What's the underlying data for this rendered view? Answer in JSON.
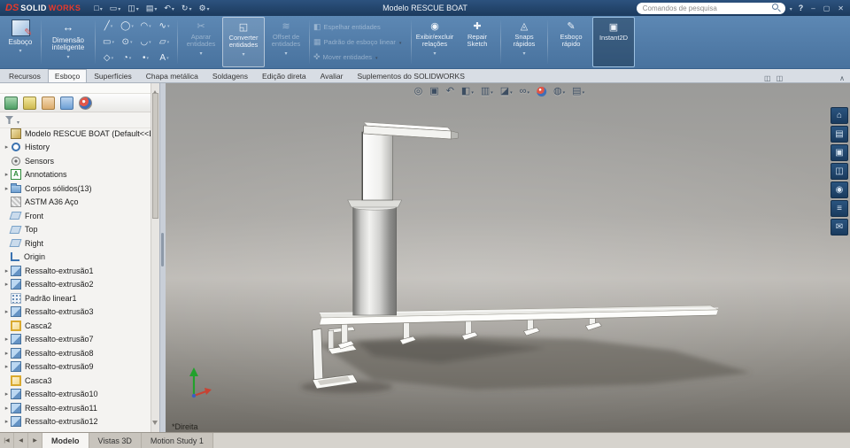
{
  "titlebar": {
    "logo_ds": "DS",
    "logo_solid": "SOLID",
    "logo_works": "WORKS",
    "title": "Modelo RESCUE BOAT",
    "search_placeholder": "Comandos de pesquisa",
    "help": "?",
    "minimize": "–",
    "maximize": "▢",
    "close": "✕",
    "quick_tools": [
      {
        "name": "new-document-icon",
        "glyph": "□"
      },
      {
        "name": "open-document-icon",
        "glyph": "▭"
      },
      {
        "name": "save-icon",
        "glyph": "◫"
      },
      {
        "name": "print-icon",
        "glyph": "▤"
      },
      {
        "name": "undo-icon",
        "glyph": "↶"
      },
      {
        "name": "rebuild-icon",
        "glyph": "↻"
      },
      {
        "name": "options-icon",
        "glyph": "⚙"
      }
    ]
  },
  "ribbon": {
    "sketch": {
      "label": "Esboço"
    },
    "smart_dimension": {
      "label": "Dimensão inteligente",
      "icon": "↔"
    },
    "sketch_tools": [
      {
        "name": "line-icon",
        "glyph": "╱"
      },
      {
        "name": "circle-icon",
        "glyph": "◯"
      },
      {
        "name": "arc-icon",
        "glyph": "◠"
      },
      {
        "name": "spline-icon",
        "glyph": "∿"
      },
      {
        "name": "rectangle-icon",
        "glyph": "▭"
      },
      {
        "name": "perimeter-circle-icon",
        "glyph": "⊙"
      },
      {
        "name": "tangent-arc-icon",
        "glyph": "◡"
      },
      {
        "name": "parallelogram-icon",
        "glyph": "▱"
      },
      {
        "name": "polygon-icon",
        "glyph": "◇"
      },
      {
        "name": "ellipse-icon",
        "glyph": "◔"
      },
      {
        "name": "point-icon",
        "glyph": "•"
      },
      {
        "name": "text-icon",
        "glyph": "A"
      }
    ],
    "trim": {
      "label": "Aparar entidades",
      "icon": "✂"
    },
    "convert": {
      "label": "Converter entidades",
      "icon": "◱"
    },
    "offset": {
      "label": "Offset de entidades",
      "icon": "≋"
    },
    "row_buttons": [
      {
        "name": "mirror-entities-button",
        "label": "Espelhar entidades",
        "icon": "◧",
        "caret": ""
      },
      {
        "name": "linear-sketch-pattern-button",
        "label": "Padrão de esboço linear",
        "icon": "▦",
        "caret": "c"
      },
      {
        "name": "move-entities-button",
        "label": "Mover entidades",
        "icon": "✜",
        "caret": "c"
      }
    ],
    "relations": {
      "label": "Exibir/excluir relações",
      "icon": "◉"
    },
    "repair": {
      "label": "Repair Sketch",
      "icon": "✚"
    },
    "snaps": {
      "label": "Snaps rápidos",
      "icon": "◬"
    },
    "rapid_sketch": {
      "label": "Esboço rápido",
      "icon": "✎"
    },
    "instant2d": {
      "label": "Instant2D",
      "icon": "▣"
    }
  },
  "command_tabs": [
    {
      "label": "Recursos",
      "state": ""
    },
    {
      "label": "Esboço",
      "state": "active"
    },
    {
      "label": "Superfícies",
      "state": ""
    },
    {
      "label": "Chapa metálica",
      "state": ""
    },
    {
      "label": "Soldagens",
      "state": ""
    },
    {
      "label": "Edição direta",
      "state": ""
    },
    {
      "label": "Avaliar",
      "state": ""
    },
    {
      "label": "Suplementos do SOLIDWORKS",
      "state": ""
    }
  ],
  "tab_icons": [
    {
      "name": "undock-commandmanager-icon",
      "glyph": "◫"
    },
    {
      "name": "split-view-icon",
      "glyph": "◫"
    }
  ],
  "tab_icons_right": [
    {
      "name": "collapse-ribbon-icon",
      "glyph": "∧"
    }
  ],
  "panel": {
    "more": "»",
    "tabs": [
      {
        "name": "featuremanager-tree-icon",
        "cls": "pt-tree"
      },
      {
        "name": "propertymanager-icon",
        "cls": "pt-prop"
      },
      {
        "name": "configurationmanager-icon",
        "cls": "pt-config"
      },
      {
        "name": "dimxpertmanager-icon",
        "cls": "pt-dim"
      },
      {
        "name": "displaymanager-icon",
        "cls": "pt-display"
      }
    ]
  },
  "tree": {
    "root": "Modelo RESCUE BOAT  (Default<<Default",
    "items": [
      {
        "label": "History",
        "icon": "history",
        "icon_name": "history-icon",
        "arrow": "▸"
      },
      {
        "label": "Sensors",
        "icon": "sensors",
        "icon_name": "sensors-icon",
        "arrow": ""
      },
      {
        "label": "Annotations",
        "icon": "annotations",
        "icon_name": "annotations-icon",
        "arrow": "▸"
      },
      {
        "label": "Corpos sólidos(13)",
        "icon": "folder",
        "icon_name": "solid-bodies-folder-icon",
        "arrow": "▸"
      },
      {
        "label": "ASTM A36 Aço",
        "icon": "material",
        "icon_name": "material-icon",
        "arrow": ""
      },
      {
        "label": "Front",
        "icon": "plane",
        "icon_name": "front-plane-icon",
        "arrow": ""
      },
      {
        "label": "Top",
        "icon": "plane",
        "icon_name": "top-plane-icon",
        "arrow": ""
      },
      {
        "label": "Right",
        "icon": "plane",
        "icon_name": "right-plane-icon",
        "arrow": ""
      },
      {
        "label": "Origin",
        "icon": "origin",
        "icon_name": "origin-icon",
        "arrow": ""
      },
      {
        "label": "Ressalto-extrusão1",
        "icon": "extrude",
        "icon_name": "boss-extrude-icon",
        "arrow": "▸"
      },
      {
        "label": "Ressalto-extrusão2",
        "icon": "extrude",
        "icon_name": "boss-extrude-icon",
        "arrow": "▸"
      },
      {
        "label": "Padrão linear1",
        "icon": "pattern",
        "icon_name": "linear-pattern-icon",
        "arrow": ""
      },
      {
        "label": "Ressalto-extrusão3",
        "icon": "extrude",
        "icon_name": "boss-extrude-icon",
        "arrow": "▸"
      },
      {
        "label": "Casca2",
        "icon": "shell",
        "icon_name": "shell-icon",
        "arrow": ""
      },
      {
        "label": "Ressalto-extrusão7",
        "icon": "extrude",
        "icon_name": "boss-extrude-icon",
        "arrow": "▸"
      },
      {
        "label": "Ressalto-extrusão8",
        "icon": "extrude",
        "icon_name": "boss-extrude-icon",
        "arrow": "▸"
      },
      {
        "label": "Ressalto-extrusão9",
        "icon": "extrude",
        "icon_name": "boss-extrude-icon",
        "arrow": "▸"
      },
      {
        "label": "Casca3",
        "icon": "shell",
        "icon_name": "shell-icon",
        "arrow": ""
      },
      {
        "label": "Ressalto-extrusão10",
        "icon": "extrude",
        "icon_name": "boss-extrude-icon",
        "arrow": "▸"
      },
      {
        "label": "Ressalto-extrusão11",
        "icon": "extrude",
        "icon_name": "boss-extrude-icon",
        "arrow": "▸"
      },
      {
        "label": "Ressalto-extrusão12",
        "icon": "extrude",
        "icon_name": "boss-extrude-icon",
        "arrow": "▸"
      }
    ]
  },
  "viewport": {
    "view_label": "*Direita",
    "hud": [
      {
        "name": "zoom-to-fit-icon",
        "glyph": "◎",
        "caret": "",
        "cls": ""
      },
      {
        "name": "zoom-to-area-icon",
        "glyph": "▣",
        "caret": "",
        "cls": ""
      },
      {
        "name": "previous-view-icon",
        "glyph": "↶",
        "caret": "",
        "cls": ""
      },
      {
        "name": "section-view-icon",
        "glyph": "◧",
        "caret": "c",
        "cls": ""
      },
      {
        "name": "view-orientation-icon",
        "glyph": "▥",
        "caret": "c",
        "cls": ""
      },
      {
        "name": "display-style-icon",
        "glyph": "◪",
        "caret": "c",
        "cls": ""
      },
      {
        "name": "hide-show-items-icon",
        "glyph": "∞",
        "caret": "c",
        "cls": ""
      },
      {
        "name": "edit-appearance-icon",
        "glyph": "",
        "caret": "",
        "cls": "ball"
      },
      {
        "name": "apply-scene-icon",
        "glyph": "◍",
        "caret": "c",
        "cls": ""
      },
      {
        "name": "view-settings-icon",
        "glyph": "▤",
        "caret": "c",
        "cls": ""
      }
    ],
    "task_pane": [
      {
        "name": "home-icon",
        "glyph": "⌂"
      },
      {
        "name": "design-library-icon",
        "glyph": "▤"
      },
      {
        "name": "file-explorer-icon",
        "glyph": "▣"
      },
      {
        "name": "view-palette-icon",
        "glyph": "◫"
      },
      {
        "name": "appearances-icon",
        "glyph": "◉"
      },
      {
        "name": "custom-properties-icon",
        "glyph": "≡"
      },
      {
        "name": "forum-icon",
        "glyph": "✉"
      }
    ]
  },
  "bottom": {
    "nav": [
      {
        "name": "scroll-tabs-start-button",
        "glyph": "|◀"
      },
      {
        "name": "scroll-tabs-left-button",
        "glyph": "◀"
      },
      {
        "name": "scroll-tabs-right-button",
        "glyph": "▶"
      }
    ],
    "tabs": [
      {
        "label": "Modelo",
        "state": "active"
      },
      {
        "label": "Vistas 3D",
        "state": ""
      },
      {
        "label": "Motion Study 1",
        "state": ""
      }
    ]
  }
}
